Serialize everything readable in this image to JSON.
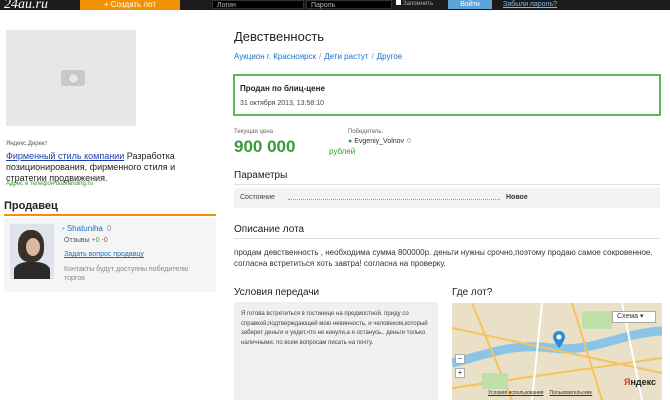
{
  "header": {
    "logo": "24au.ru",
    "create_lot": "+ Создать лот",
    "login_placeholder": "Логин",
    "password_placeholder": "Пароль",
    "remember_label": "Запомнить",
    "login_button": "Войти",
    "forgot_link": "Забыли пароль?"
  },
  "ad": {
    "label": "Яндекс.Директ",
    "title_link": "Фирменный стиль компании",
    "title_rest": " Разработка позиционирования, фирменного стиля и стратегии продвижения.",
    "contact": "Адрес и телефон  dobranding.ru"
  },
  "seller": {
    "heading": "Продавец",
    "name": "Shatuniha",
    "name_count": "0",
    "reviews_label": "Отзывы",
    "reviews_pos": "+0",
    "reviews_neg": "-0",
    "ask_link": "Задать вопрос продавцу",
    "contacts_note": "Контакты будут доступны победителю торгов"
  },
  "lot": {
    "title": "Девственность",
    "breadcrumbs": [
      "Аукцион г. Красноярск",
      "Дети растут",
      "Другое"
    ],
    "status_title": "Продан по блиц-цене",
    "status_date": "31 октября 2013, 13:58:10",
    "price_label": "Текущая цена",
    "price": "900 000",
    "price_unit": "рублей",
    "winner_label": "Победитель:",
    "winner_name": "Evgeniy_Volnov",
    "winner_count": "0"
  },
  "params": {
    "heading": "Параметры",
    "rows": [
      {
        "name": "Состояние",
        "value": "Новое"
      }
    ]
  },
  "description": {
    "heading": "Описание лота",
    "text": "продам девственность , необходима сумма 800000р. деньги нужны срочно,поэтому продаю самое сокровенное. согласна встретиться хоть завтра! согласна на проверку."
  },
  "conditions": {
    "heading": "Условия передачи",
    "text": "Я готова встретиться в гостинице на предмостной. приду со справкой,подтверждающей мою невинность, и человеком,который заберет деньги и уедет,что не кинули,а я останусь.. деньги только наличными. по всем вопросам писать на почту."
  },
  "map": {
    "heading": "Где лот?",
    "scheme_button": "Схема",
    "zoom_in": "+",
    "zoom_out": "−",
    "brand_first": "Я",
    "brand_rest": "ндекс",
    "links": [
      "Условия использования",
      "Пользовательские"
    ]
  }
}
